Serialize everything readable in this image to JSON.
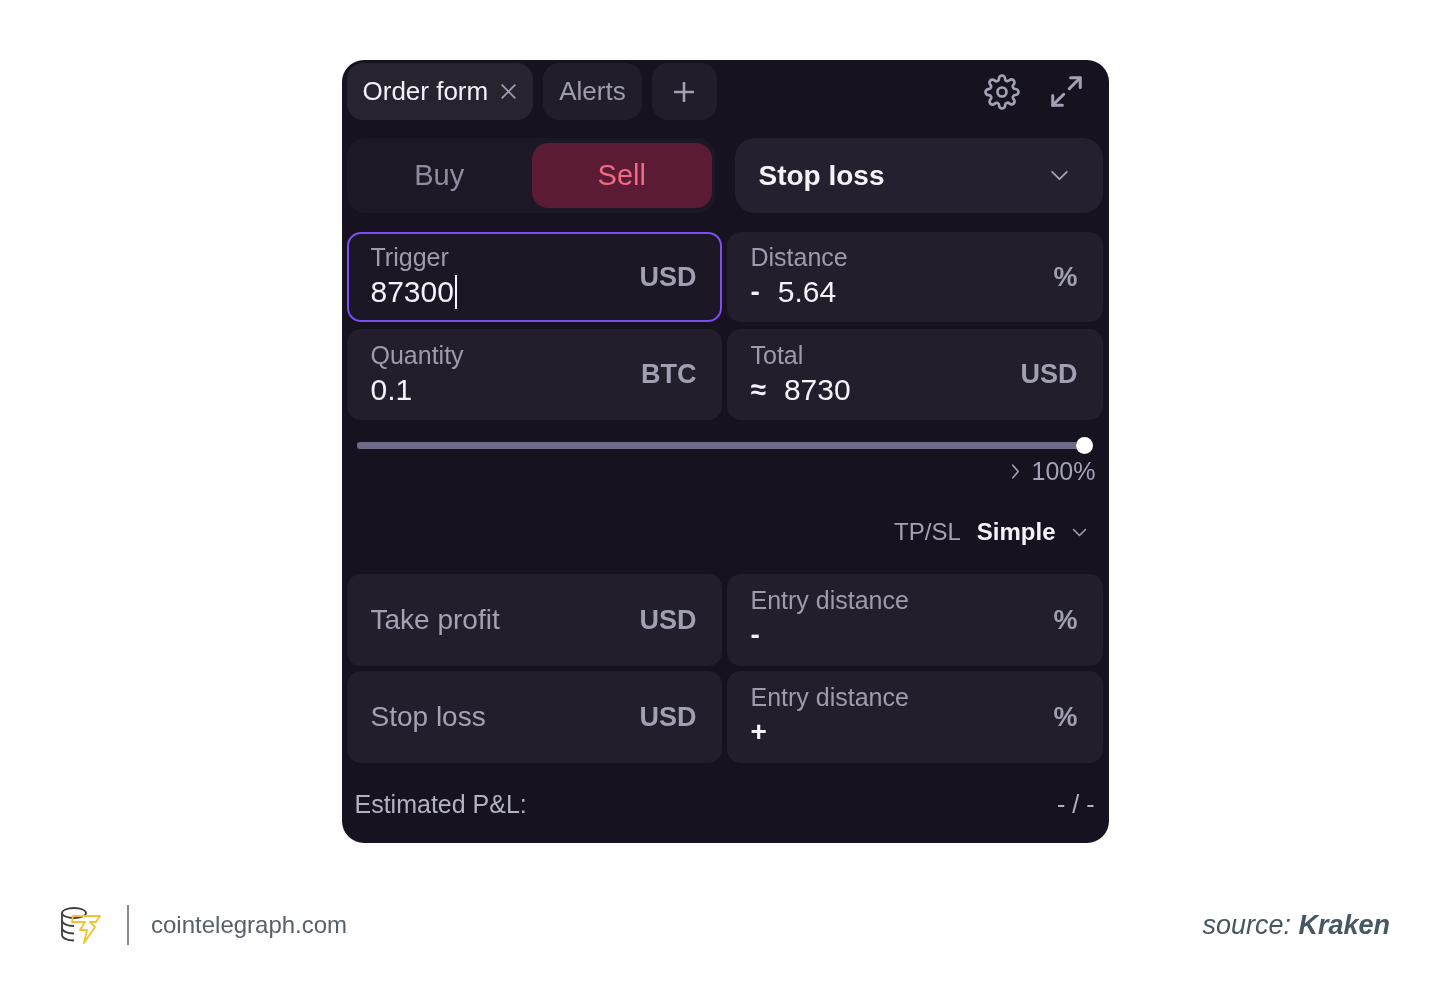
{
  "tabs": [
    {
      "label": "Order form",
      "selected": true,
      "closable": true
    },
    {
      "label": "Alerts",
      "selected": false,
      "closable": false
    }
  ],
  "side": [
    {
      "label": "Buy",
      "selected": false
    },
    {
      "label": "Sell",
      "selected": true
    }
  ],
  "order_type": {
    "value": "Stop loss"
  },
  "order_fields": [
    {
      "label": "Trigger",
      "value": "87300",
      "unit": "USD",
      "focused": true
    },
    {
      "label": "Distance",
      "sign": "-",
      "value": "5.64",
      "unit": "%",
      "focused": false
    },
    {
      "label": "Quantity",
      "value": "0.1",
      "unit": "BTC",
      "focused": false
    },
    {
      "label": "Total",
      "sign": "≈",
      "value": "8730",
      "unit": "USD",
      "focused": false
    }
  ],
  "slider": {
    "level": 1.0,
    "reading": "100%"
  },
  "tpsl": {
    "label": "TP/SL",
    "mode": "Simple"
  },
  "tpsl_fields": [
    {
      "placeholder": "Take profit",
      "unit": "USD",
      "focused": false
    },
    {
      "label": "Entry distance",
      "sign": "-",
      "unit": "%",
      "focused": false
    },
    {
      "placeholder": "Stop loss",
      "unit": "USD",
      "focused": false
    },
    {
      "label": "Entry distance",
      "sign": "+",
      "unit": "%",
      "focused": false
    }
  ],
  "estimated_pnl": {
    "label": "Estimated P&L:",
    "value": "- / -"
  },
  "footer": {
    "site": "cointelegraph.com",
    "source": "source: **Kraken**"
  }
}
